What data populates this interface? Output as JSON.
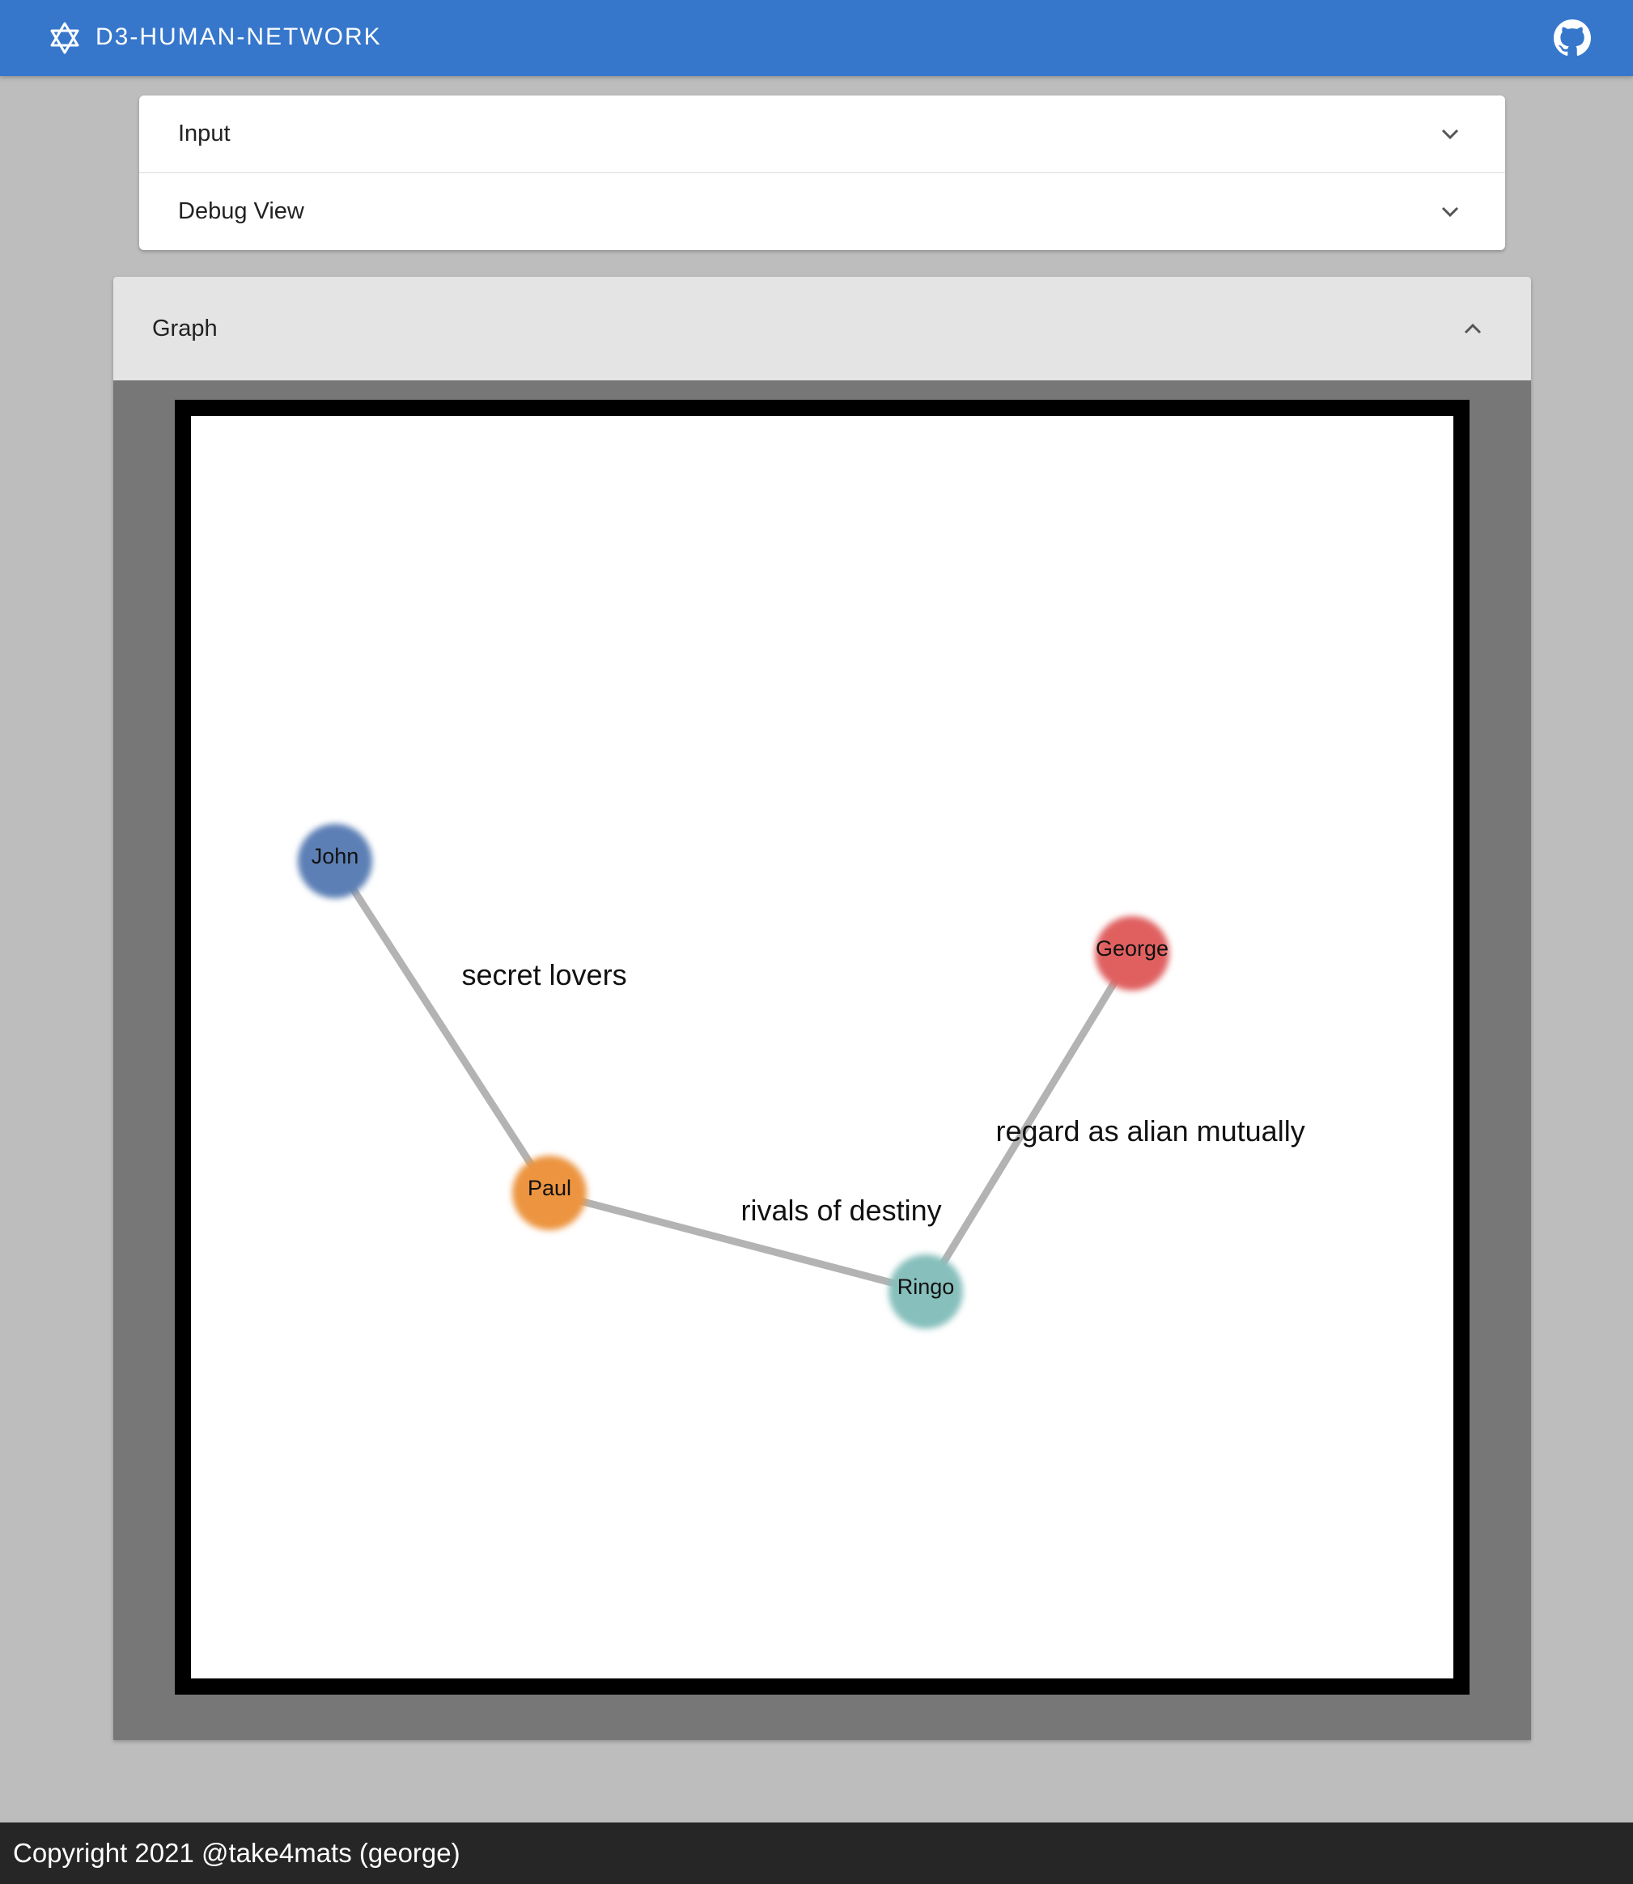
{
  "appbar": {
    "title": "D3-HUMAN-NETWORK",
    "logo_icon": "star-of-david-icon",
    "repo_icon": "github-icon",
    "color": "#3677cc"
  },
  "accordion": {
    "items": [
      {
        "label": "Input",
        "icon": "chevron-down-icon",
        "expanded": false
      },
      {
        "label": "Debug View",
        "icon": "chevron-down-icon",
        "expanded": false
      }
    ]
  },
  "graph_panel": {
    "label": "Graph",
    "icon": "chevron-up-icon",
    "expanded": true
  },
  "graph": {
    "nodes": [
      {
        "id": "John",
        "label": "John",
        "color": "#5b7fb5"
      },
      {
        "id": "Paul",
        "label": "Paul",
        "color": "#ec9440"
      },
      {
        "id": "Ringo",
        "label": "Ringo",
        "color": "#86bfbc"
      },
      {
        "id": "George",
        "label": "George",
        "color": "#e06161"
      }
    ],
    "links": [
      {
        "source": "John",
        "target": "Paul",
        "label": "secret lovers"
      },
      {
        "source": "Paul",
        "target": "Ringo",
        "label": "rivals of destiny"
      },
      {
        "source": "Ringo",
        "target": "George",
        "label": "regard as alian mutually"
      }
    ],
    "link_color": "#b3b3b3"
  },
  "footer": {
    "text": "Copyright 2021 @take4mats (george)"
  }
}
